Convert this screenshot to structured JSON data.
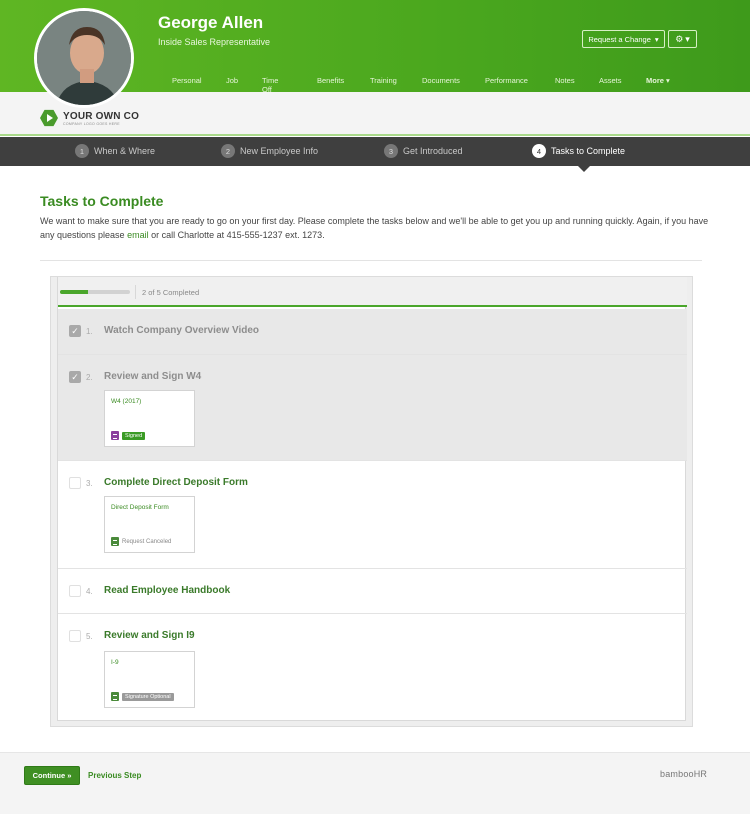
{
  "profile": {
    "name": "George Allen",
    "role": "Inside Sales Representative"
  },
  "header": {
    "request_change_label": "Request a Change",
    "gear_caret": "▾",
    "nav": [
      "Personal",
      "Job",
      "Time Off",
      "Benefits",
      "Training",
      "Documents",
      "Performance",
      "Notes",
      "Assets",
      "More"
    ]
  },
  "company": {
    "name": "YOUR OWN CO",
    "tagline": "COMPANY LOGO GOES HERE"
  },
  "steps": [
    {
      "num": "1",
      "label": "When & Where",
      "active": false
    },
    {
      "num": "2",
      "label": "New Employee Info",
      "active": false
    },
    {
      "num": "3",
      "label": "Get Introduced",
      "active": false
    },
    {
      "num": "4",
      "label": "Tasks to Complete",
      "active": true
    }
  ],
  "content": {
    "title": "Tasks to Complete",
    "desc_before": "We want to make sure that you are ready to go on your first day. Please complete the tasks below and we'll be able to get you up and running quickly. Again, if you have any questions please ",
    "desc_link": "email",
    "desc_after": " or call Charlotte at 415-555-1237 ext. 1273."
  },
  "progress": {
    "text": "2 of 5 Completed",
    "fraction": 0.4
  },
  "tasks": [
    {
      "num": "1.",
      "name": "Watch Company Overview Video",
      "done": true
    },
    {
      "num": "2.",
      "name": "Review and Sign W4",
      "done": true,
      "doc": {
        "title": "W4 (2017)",
        "status": "Signed",
        "icon": "pdf-icon"
      }
    },
    {
      "num": "3.",
      "name": "Complete Direct Deposit Form",
      "done": false,
      "doc": {
        "title": "Direct Deposit Form",
        "status": "Request Canceled",
        "icon": "document-icon"
      }
    },
    {
      "num": "4.",
      "name": "Read Employee Handbook",
      "done": false
    },
    {
      "num": "5.",
      "name": "Review and Sign I9",
      "done": false,
      "doc": {
        "title": "I-9",
        "status": "Signature Optional",
        "icon": "document-icon"
      }
    }
  ],
  "footer": {
    "continue_label": "Continue »",
    "previous_label": "Previous Step",
    "brand": "bambooHR"
  },
  "colors": {
    "brand_green": "#4aa71e",
    "link_green": "#3a8b22",
    "steps_bar": "#3f3f3f"
  }
}
